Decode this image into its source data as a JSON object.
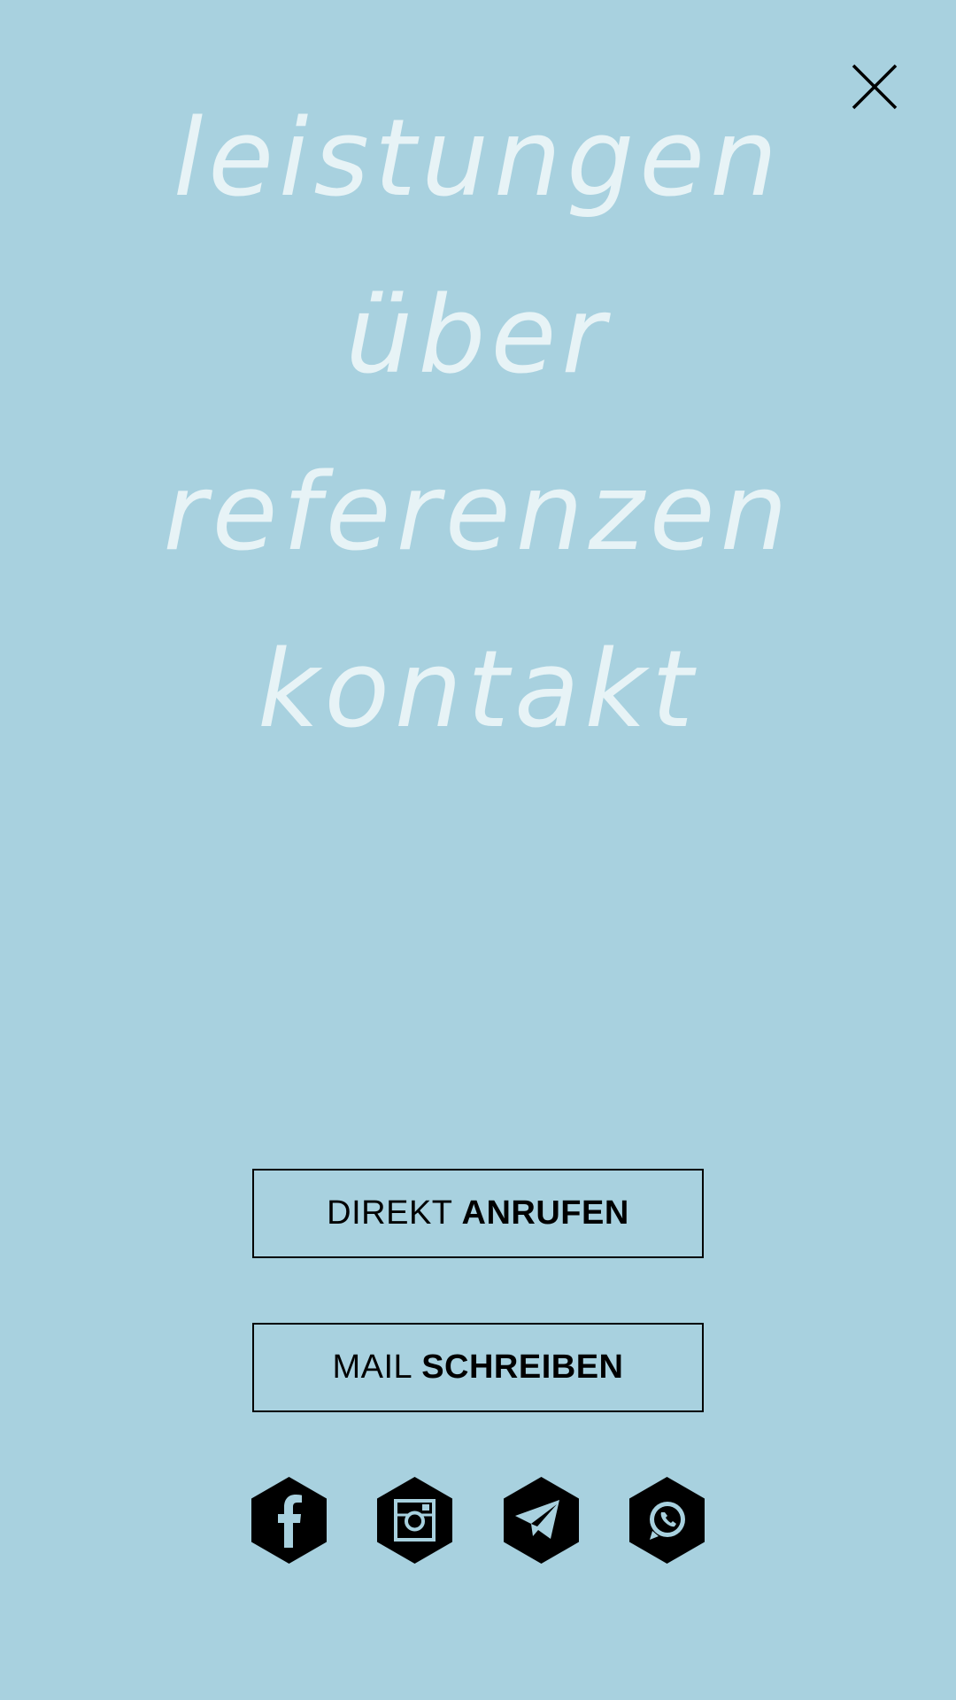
{
  "colors": {
    "background": "#a8d1df",
    "menu_text": "#e7f3f6",
    "foreground": "#000000"
  },
  "close": {
    "icon": "close-icon"
  },
  "menu": {
    "items": [
      {
        "label": "leistungen"
      },
      {
        "label": "über"
      },
      {
        "label": "referenzen"
      },
      {
        "label": "kontakt"
      }
    ]
  },
  "cta": {
    "call": {
      "light": "DIREKT",
      "bold": "ANRUFEN"
    },
    "mail": {
      "light": "MAIL",
      "bold": "SCHREIBEN"
    }
  },
  "social": [
    {
      "icon": "facebook-icon"
    },
    {
      "icon": "instagram-icon"
    },
    {
      "icon": "telegram-icon"
    },
    {
      "icon": "whatsapp-icon"
    }
  ]
}
